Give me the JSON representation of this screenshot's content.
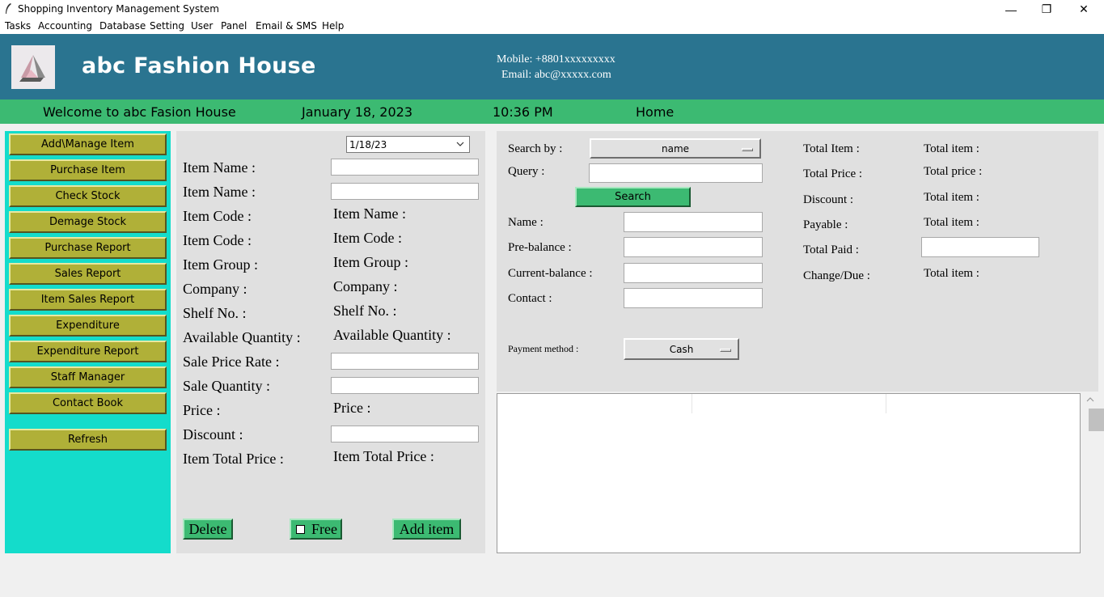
{
  "window": {
    "title": "Shopping Inventory Management System",
    "minimize": "—",
    "maximize": "❐",
    "close": "✕"
  },
  "menu": [
    "Tasks",
    "Accounting",
    "Database",
    "Setting",
    "User",
    "Panel",
    "Email & SMS",
    "Help"
  ],
  "header": {
    "shop_name": "abc Fashion House",
    "mobile": "Mobile: +8801xxxxxxxxx",
    "email": "Email: abc@xxxxx.com"
  },
  "status": {
    "welcome": "Welcome to abc Fasion House",
    "date": "January 18, 2023",
    "time": "10:36 PM",
    "page": "Home"
  },
  "sidebar": {
    "buttons": [
      "Add\\Manage Item",
      "Purchase Item",
      "Check Stock",
      "Demage Stock",
      "Purchase Report",
      "Sales Report",
      "Item Sales Report",
      "Expenditure",
      "Expenditure Report",
      "Staff Manager",
      "Contact Book"
    ],
    "refresh": "Refresh"
  },
  "item_panel": {
    "date_value": "1/18/23",
    "labels": {
      "item_name_1": "Item Name :",
      "item_name_2": "Item Name :",
      "item_code_1": "Item Code :",
      "item_code_2": "Item Code :",
      "item_group": "Item Group :",
      "company": "Company :",
      "shelf_no": "Shelf No. :",
      "available_qty": "Available Quantity :",
      "sale_price_rate": "Sale Price Rate :",
      "sale_quantity": "Sale Quantity :",
      "price": "Price :",
      "discount": "Discount :",
      "item_total_price": "Item Total Price :"
    },
    "values": {
      "item_name": "Item Name :",
      "item_code": "Item Code :",
      "item_group": "Item Group :",
      "company": "Company :",
      "shelf_no": "Shelf No. :",
      "available_qty": "Available Quantity :",
      "price": "Price :",
      "item_total_price": "Item Total Price :"
    },
    "delete_label": "Delete",
    "free_label": "Free",
    "add_item_label": "Add item"
  },
  "search_panel": {
    "search_by_label": "Search by :",
    "search_by_value": "name",
    "query_label": "Query :",
    "search_button": "Search",
    "name_label": "Name :",
    "pre_balance_label": "Pre-balance :",
    "current_balance_label": "Current-balance :",
    "contact_label": "Contact :",
    "payment_method_label": "Payment method :",
    "payment_method_value": "Cash"
  },
  "totals": {
    "total_item_label": "Total Item :",
    "total_item_value": "Total item :",
    "total_price_label": "Total Price :",
    "total_price_value": "Total price :",
    "discount_label": "Discount :",
    "discount_value": "Total item :",
    "payable_label": "Payable :",
    "payable_value": "Total item :",
    "total_paid_label": "Total Paid :",
    "change_due_label": "Change/Due :",
    "change_due_value": "Total item :"
  },
  "colors": {
    "header_bg": "#2a7490",
    "status_bg": "#3cba72",
    "sidebar_bg": "#14dccb",
    "sidebar_button": "#b0b038",
    "panel_bg": "#e0e0e0"
  }
}
